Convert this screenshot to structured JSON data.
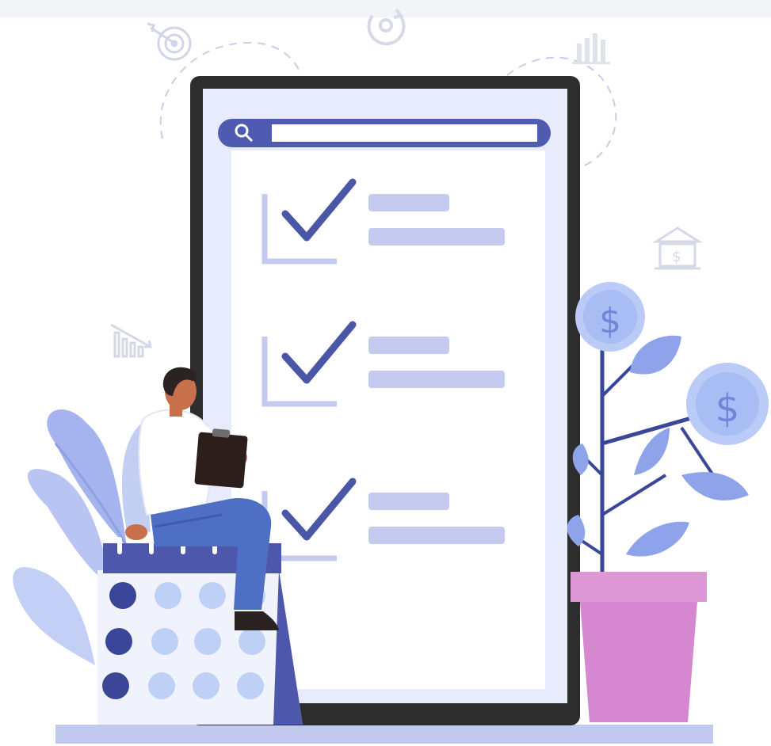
{
  "illustration": {
    "subject": "person-with-clipboard-and-checklist-phone",
    "colors": {
      "primary": "#4f5bb0",
      "phone_frame": "#2d2d2d",
      "screen": "#e8ebfb",
      "screen_inner": "#ffffff",
      "bar": "#c5caf1",
      "check": "#4a56a6",
      "leaf": "#8fa3ea",
      "coin": "#b9cbf6",
      "pot": "#d587cf",
      "pot_rim": "#dd97d7",
      "calendar_top": "#4d58ad",
      "dot_dark": "#3a4698",
      "dot_light": "#bfd0f7",
      "shirt": "#ffffff",
      "pants": "#4f6fc4",
      "skin": "#c8704c",
      "hair": "#2b2321",
      "clipboard": "#2c1f1b",
      "floor": "#c2c9ee"
    },
    "icons": [
      "target-icon",
      "refresh-icon",
      "bar-chart-icon",
      "bank-icon",
      "decline-chart-icon",
      "search-icon",
      "dollar-icon"
    ],
    "checklist_items": 3,
    "coins_symbol": "$"
  }
}
